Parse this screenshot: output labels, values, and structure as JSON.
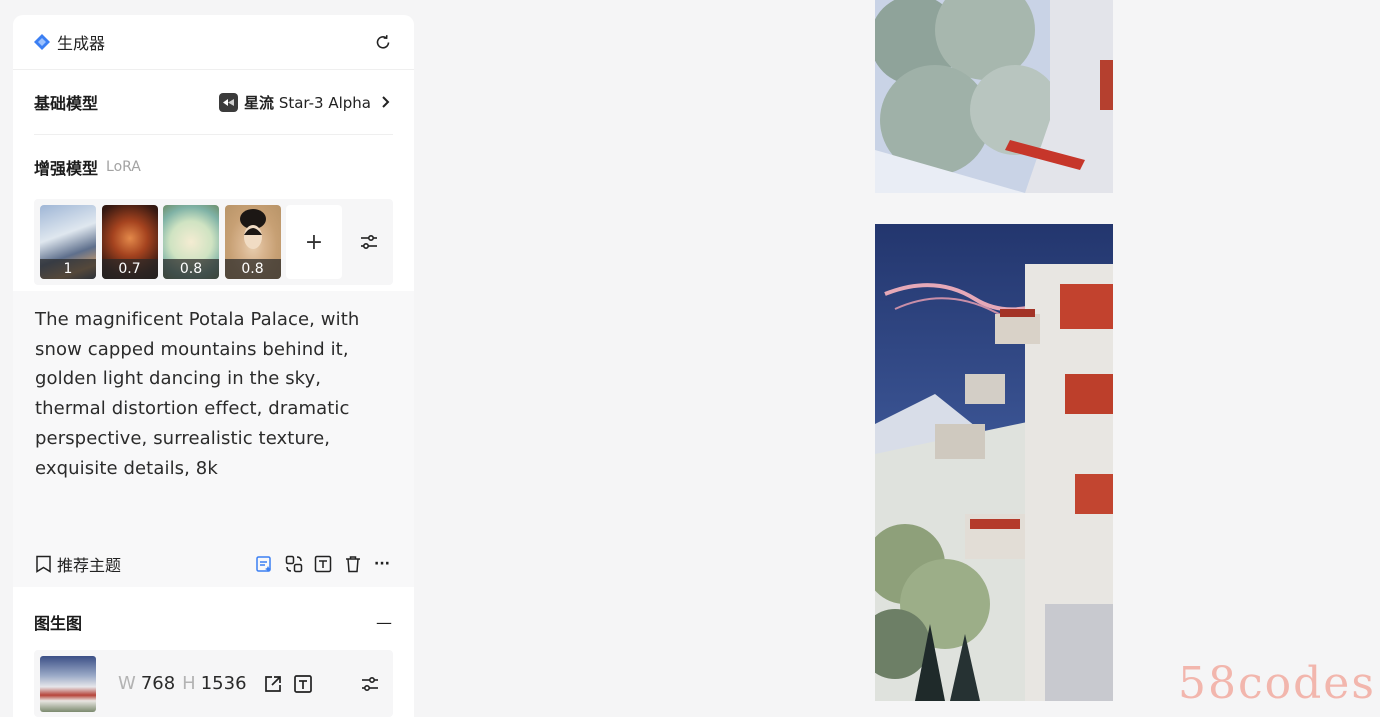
{
  "header": {
    "title": "生成器",
    "icon": "sparkle-diamond-icon",
    "reset_icon": "refresh-icon"
  },
  "base_model": {
    "label": "基础模型",
    "brand": "星流",
    "model": "Star-3 Alpha"
  },
  "lora": {
    "label": "增强模型",
    "sublabel": "LoRA",
    "items": [
      {
        "weight": "1"
      },
      {
        "weight": "0.7"
      },
      {
        "weight": "0.8"
      },
      {
        "weight": "0.8"
      }
    ],
    "add_label": "+"
  },
  "prompt": {
    "text": "The magnificent Potala Palace, with snow capped mountains behind it, golden light dancing in the sky, thermal distortion effect, dramatic perspective, surrealistic texture, exquisite details, 8k",
    "topic_label": "推荐主题",
    "more_label": "···"
  },
  "img2img": {
    "label": "图生图",
    "collapse_label": "—",
    "width_key": "W",
    "width": "768",
    "height_key": "H",
    "height": "1536"
  },
  "watermark": "58codes",
  "colors": {
    "accent": "#3b7ff3",
    "panel_bg": "#ffffff",
    "page_bg": "#f5f5f6"
  }
}
